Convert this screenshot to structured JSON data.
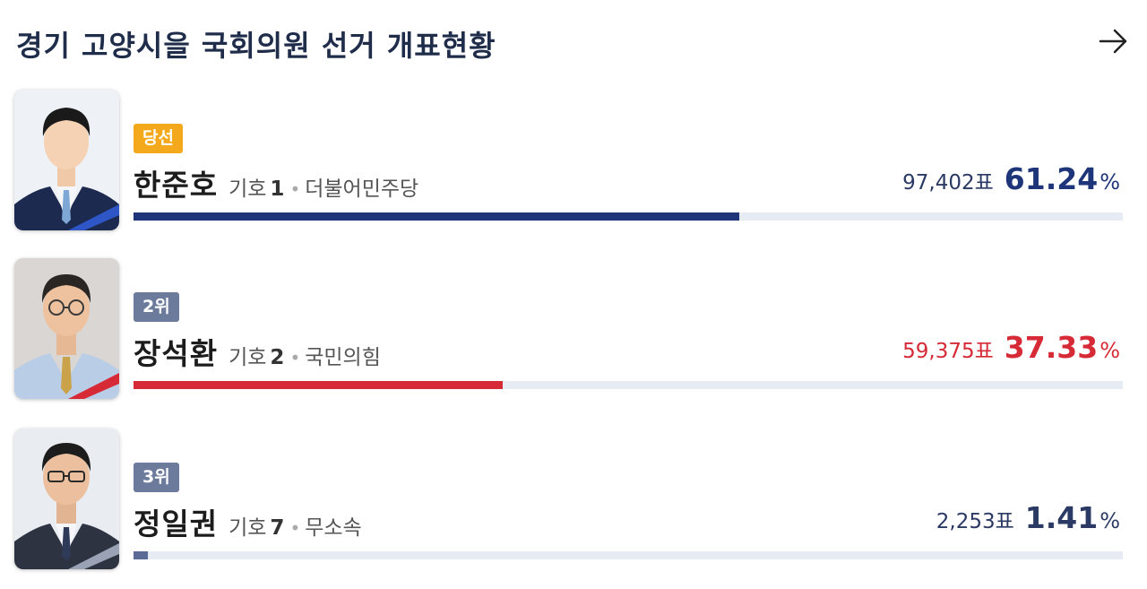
{
  "header": {
    "title": "경기 고양시을 국회의원 선거 개표현황",
    "more_icon": "arrow-right-icon"
  },
  "colors": {
    "title": "#1f2d4a",
    "winner_badge": "#f4a91c",
    "rank_badge": "#6c7a9c",
    "bar_track": "#e7ebf3",
    "democratic": "#1f3579",
    "ppp": "#d62b37",
    "independent": "#5b6b95"
  },
  "candidates": [
    {
      "badge": "당선",
      "name": "한준호",
      "giho_label": "기호",
      "giho_number": "1",
      "separator": "•",
      "party": "더불어민주당",
      "votes": "97,402표",
      "percent": "61.24",
      "percent_sign": "%",
      "share": 0.6124,
      "color": "#1f3579"
    },
    {
      "badge": "2위",
      "name": "장석환",
      "giho_label": "기호",
      "giho_number": "2",
      "separator": "•",
      "party": "국민의힘",
      "votes": "59,375표",
      "percent": "37.33",
      "percent_sign": "%",
      "share": 0.3733,
      "color": "#d62b37"
    },
    {
      "badge": "3위",
      "name": "정일권",
      "giho_label": "기호",
      "giho_number": "7",
      "separator": "•",
      "party": "무소속",
      "votes": "2,253표",
      "percent": "1.41",
      "percent_sign": "%",
      "share": 0.0141,
      "color": "#5b6b95"
    }
  ]
}
